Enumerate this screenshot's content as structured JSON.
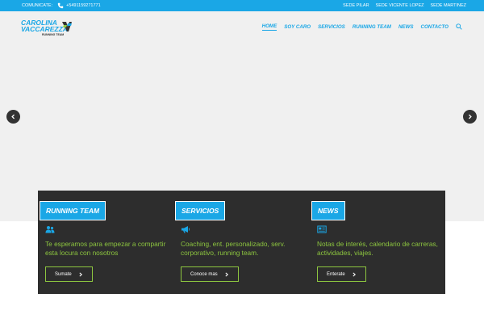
{
  "colors": {
    "accent": "#1aa7e6",
    "green": "#8dc63f",
    "panel": "#2d2d2d",
    "hero": "#f0f0f0"
  },
  "topbar": {
    "contact_label": "COMUNICATE:",
    "phone": "+5491159271771",
    "sedes": [
      "SEDE PILAR",
      "SEDE VICENTE LOPEZ",
      "SEDE MARTINEZ"
    ]
  },
  "logo": {
    "line1": "CAROLINA",
    "line2": "VACCAREZZA",
    "line3": "RUNNING TEAM"
  },
  "nav": {
    "items": [
      "HOME",
      "SOY CARO",
      "SERVICIOS",
      "RUNNING TEAM",
      "NEWS",
      "CONTACTO"
    ],
    "active": "HOME",
    "search_icon": "search-icon"
  },
  "slider": {
    "prev_icon": "chevron-left-icon",
    "next_icon": "chevron-right-icon"
  },
  "features": [
    {
      "title": "RUNNING TEAM",
      "icon": "users-icon",
      "text": "Te esperamos para empezar a compartir esta locura con nosotros",
      "button": "Sumate"
    },
    {
      "title": "SERVICIOS",
      "icon": "megaphone-icon",
      "text": "Coaching, ent. personalizado, serv. corporativo, running team.",
      "button": "Conoce mas"
    },
    {
      "title": "NEWS",
      "icon": "newspaper-icon",
      "text": "Notas de interés, calendario de carreras, actividades, viajes.",
      "button": "Enterate"
    }
  ]
}
